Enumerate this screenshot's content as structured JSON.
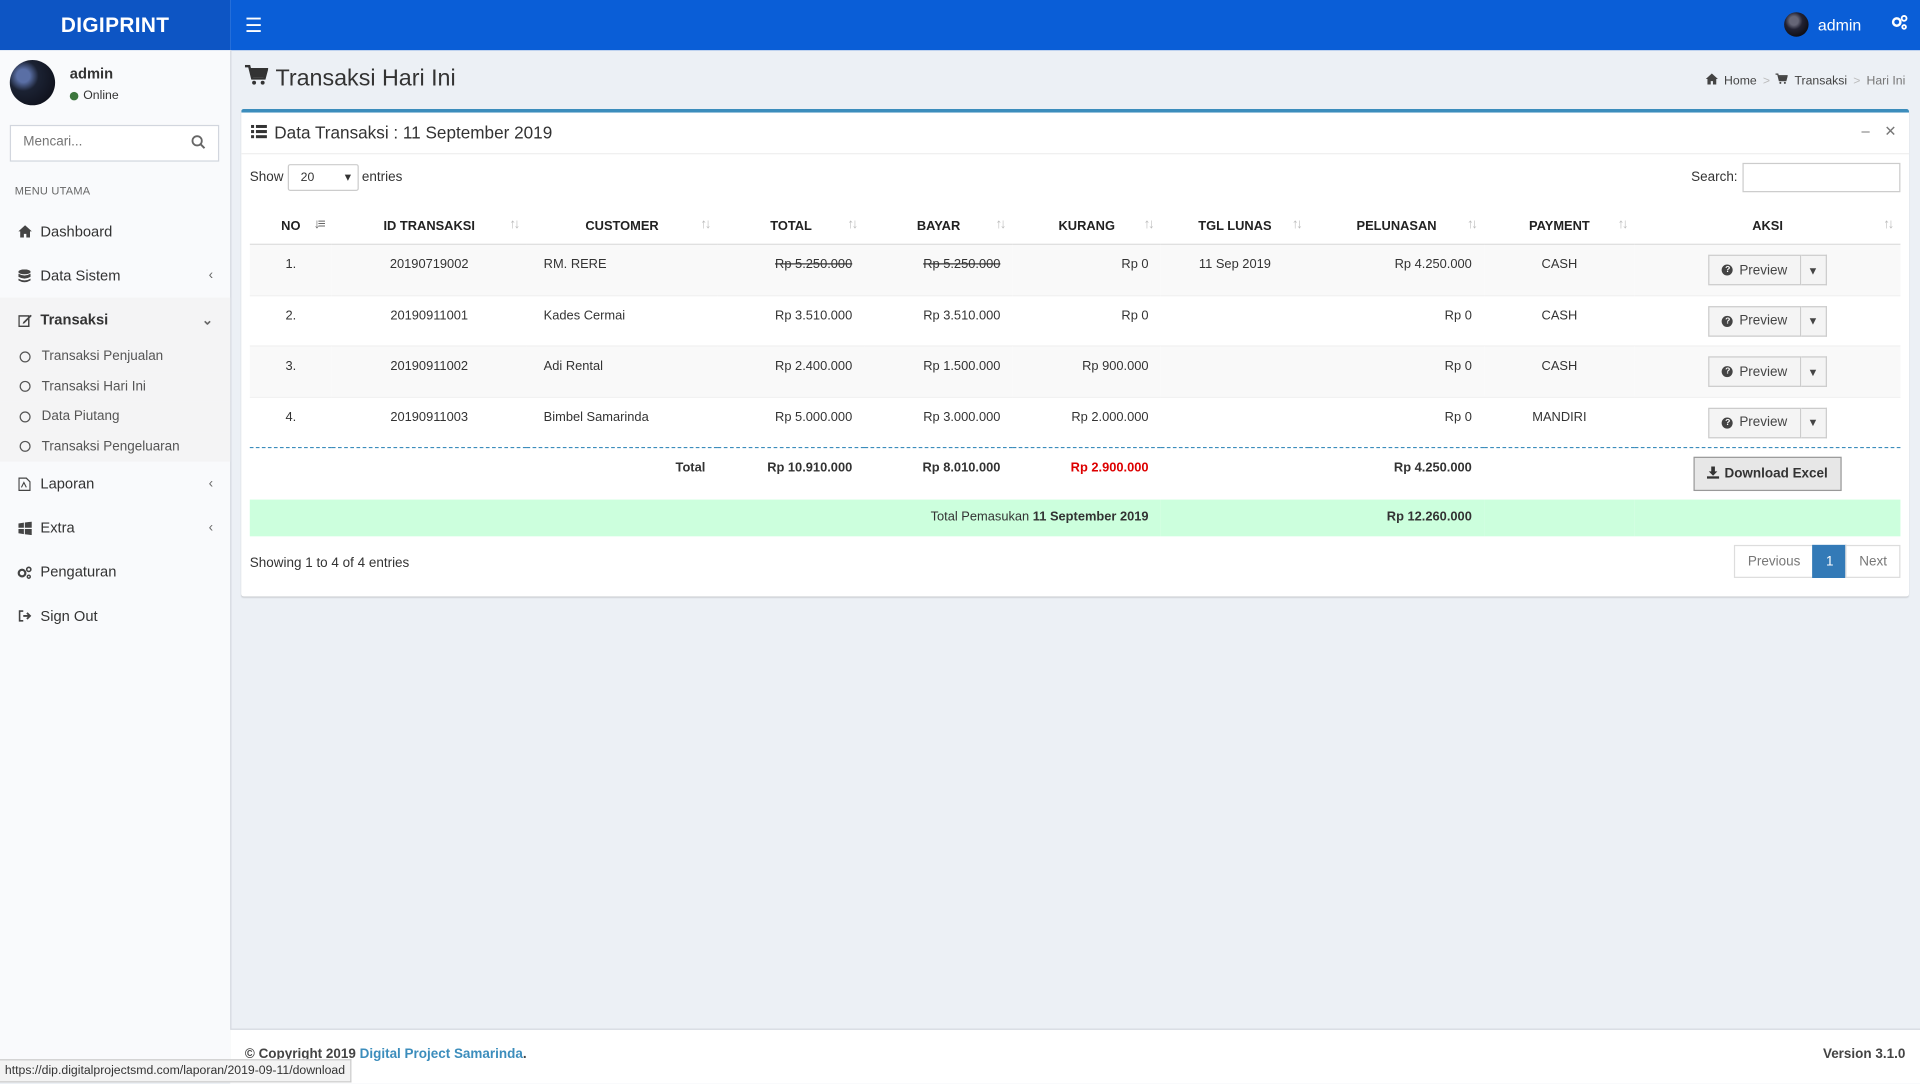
{
  "app": {
    "logo": "DIGIPRINT",
    "user": "admin"
  },
  "sidebar": {
    "user_name": "admin",
    "status": "Online",
    "search_placeholder": "Mencari...",
    "menu_header": "MENU UTAMA",
    "items": [
      {
        "label": "Dashboard",
        "icon": "home-icon"
      },
      {
        "label": "Data Sistem",
        "icon": "database-icon"
      },
      {
        "label": "Transaksi",
        "icon": "edit-icon"
      },
      {
        "label": "Laporan",
        "icon": "file-pdf-icon"
      },
      {
        "label": "Extra",
        "icon": "windows-icon"
      },
      {
        "label": "Pengaturan",
        "icon": "gears-icon"
      },
      {
        "label": "Sign Out",
        "icon": "sign-out-icon"
      }
    ],
    "subitems": [
      "Transaksi Penjualan",
      "Transaksi Hari Ini",
      "Data Piutang",
      "Transaksi Pengeluaran"
    ]
  },
  "page": {
    "title": "Transaksi Hari Ini",
    "breadcrumb": [
      "Home",
      "Transaksi",
      "Hari Ini"
    ]
  },
  "box": {
    "title": "Data Transaksi : 11 September 2019",
    "show_label": "Show",
    "entries_value": "20",
    "entries_label": "entries",
    "search_label": "Search:"
  },
  "table": {
    "headers": [
      "NO",
      "ID TRANSAKSI",
      "CUSTOMER",
      "TOTAL",
      "BAYAR",
      "KURANG",
      "TGL LUNAS",
      "PELUNASAN",
      "PAYMENT",
      "AKSI"
    ],
    "rows": [
      {
        "no": "1.",
        "id": "20190719002",
        "customer": "RM. RERE",
        "total": "Rp 5.250.000",
        "bayar": "Rp 5.250.000",
        "kurang": "Rp 0",
        "tgl_lunas": "11 Sep 2019",
        "pelunasan": "Rp 4.250.000",
        "payment": "CASH",
        "action": "Preview"
      },
      {
        "no": "2.",
        "id": "20190911001",
        "customer": "Kades Cermai",
        "total": "Rp 3.510.000",
        "bayar": "Rp 3.510.000",
        "kurang": "Rp 0",
        "tgl_lunas": "",
        "pelunasan": "Rp 0",
        "payment": "CASH",
        "action": "Preview"
      },
      {
        "no": "3.",
        "id": "20190911002",
        "customer": "Adi Rental",
        "total": "Rp 2.400.000",
        "bayar": "Rp 1.500.000",
        "kurang": "Rp 900.000",
        "tgl_lunas": "",
        "pelunasan": "Rp 0",
        "payment": "CASH",
        "action": "Preview"
      },
      {
        "no": "4.",
        "id": "20190911003",
        "customer": "Bimbel Samarinda",
        "total": "Rp 5.000.000",
        "bayar": "Rp 3.000.000",
        "kurang": "Rp 2.000.000",
        "tgl_lunas": "",
        "pelunasan": "Rp 0",
        "payment": "MANDIRI",
        "action": "Preview"
      }
    ],
    "total_label": "Total",
    "total_total": "Rp 10.910.000",
    "total_bayar": "Rp 8.010.000",
    "total_kurang": "Rp 2.900.000",
    "total_pelunasan": "Rp 4.250.000",
    "download_label": "Download Excel",
    "pemasukan_label": "Total Pemasukan",
    "pemasukan_date": "11 September 2019",
    "pemasukan_value": "Rp 12.260.000"
  },
  "footer_info": "Showing 1 to 4 of 4 entries",
  "pagination": {
    "previous": "Previous",
    "current": "1",
    "next": "Next"
  },
  "footer": {
    "copyright": "© Copyright 2019",
    "company": "Digital Project Samarinda",
    "version": "Version 3.1.0"
  },
  "status_url": "https://dip.digitalprojectsmd.com/laporan/2019-09-11/download",
  "colors": {
    "header": "#0a5ed7",
    "logo_bg": "#0d55c4",
    "accent": "#3c8dbc",
    "danger": "#dd0000",
    "pemasukan_bg": "#ccffdd"
  }
}
